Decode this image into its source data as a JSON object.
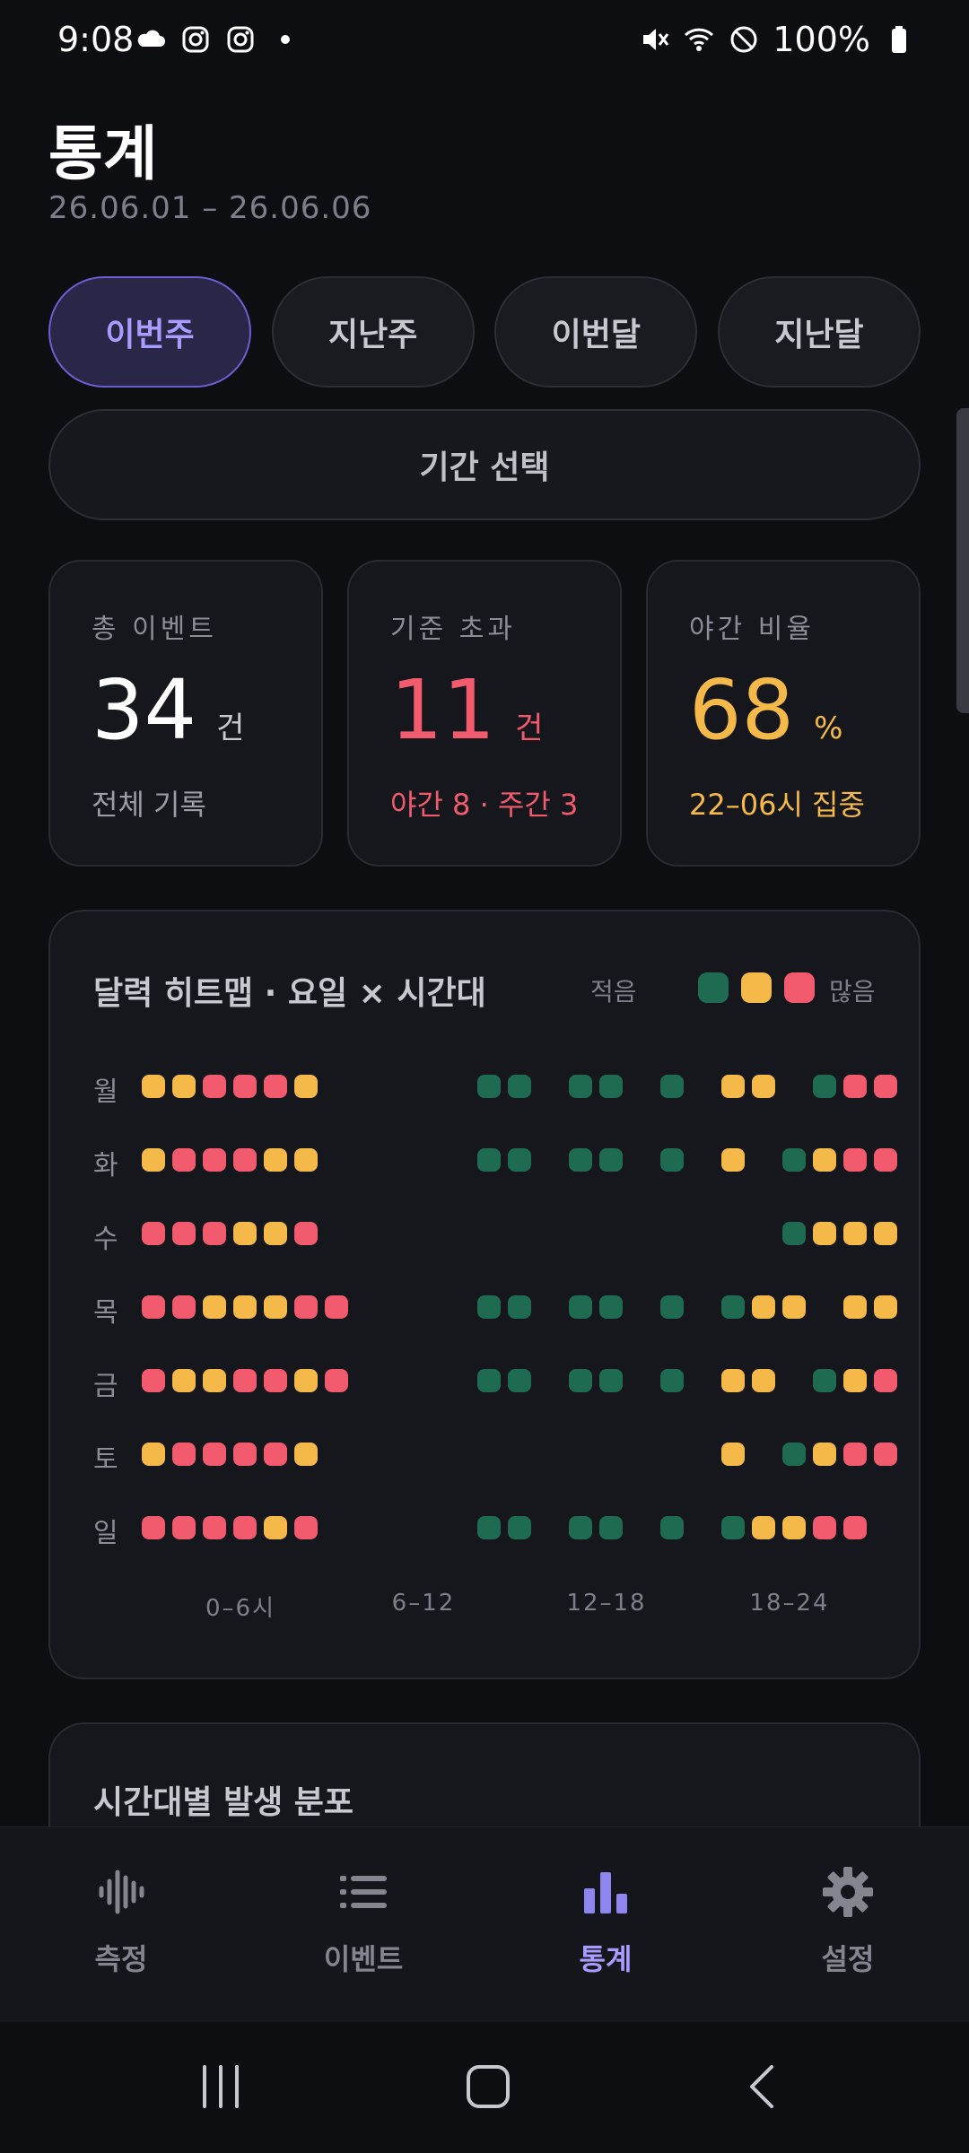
{
  "status_bar": {
    "time": "9:08",
    "battery": "100%"
  },
  "header": {
    "title": "통계",
    "range": "26.06.01 – 26.06.06"
  },
  "period_chips": [
    {
      "label": "이번주",
      "active": true
    },
    {
      "label": "지난주",
      "active": false
    },
    {
      "label": "이번달",
      "active": false
    },
    {
      "label": "지난달",
      "active": false
    }
  ],
  "period_select_label": "기간 선택",
  "stats": [
    {
      "label": "총 이벤트",
      "value": "34",
      "unit": "건",
      "sub": "전체 기록",
      "tone": "neutral"
    },
    {
      "label": "기준 초과",
      "value": "11",
      "unit": "건",
      "sub": "야간 8 · 주간 3",
      "tone": "red"
    },
    {
      "label": "야간 비율",
      "value": "68",
      "unit": "%",
      "sub": "22–06시 집중",
      "tone": "amber"
    }
  ],
  "heatmap": {
    "title": "달력 히트맵 · 요일 × 시간대",
    "legend_less": "적음",
    "legend_more": "많음",
    "axis_labels": [
      "0–6시",
      "6–12",
      "12–18",
      "18–24"
    ],
    "rows": [
      {
        "day": "월",
        "cells": "YYRRRY.....GG.GG.G.YY.GRR"
      },
      {
        "day": "화",
        "cells": "YRRRYY.....GG.GG.G.Y.GYRR"
      },
      {
        "day": "수",
        "cells": "RRRYYR...............GYYY"
      },
      {
        "day": "목",
        "cells": "RRYYYRR....GG.GG.G.GYY.YY"
      },
      {
        "day": "금",
        "cells": "RYYRRYR....GG.GG.G.YY.GYR"
      },
      {
        "day": "토",
        "cells": "YRRRRY.............Y.GYRR"
      },
      {
        "day": "일",
        "cells": "RRRRYR.....GG.GG.G.GYYRR"
      }
    ]
  },
  "distribution": {
    "title": "시간대별 발생 분포"
  },
  "bottom_nav": [
    {
      "label": "측정",
      "icon": "waveform-icon",
      "active": false
    },
    {
      "label": "이벤트",
      "icon": "list-icon",
      "active": false
    },
    {
      "label": "통계",
      "icon": "bar-chart-icon",
      "active": true
    },
    {
      "label": "설정",
      "icon": "gear-icon",
      "active": false
    }
  ],
  "colors": {
    "accent": "#a79cff",
    "red": "#f25a6e",
    "amber": "#f5b94a",
    "green": "#1f6b52"
  }
}
